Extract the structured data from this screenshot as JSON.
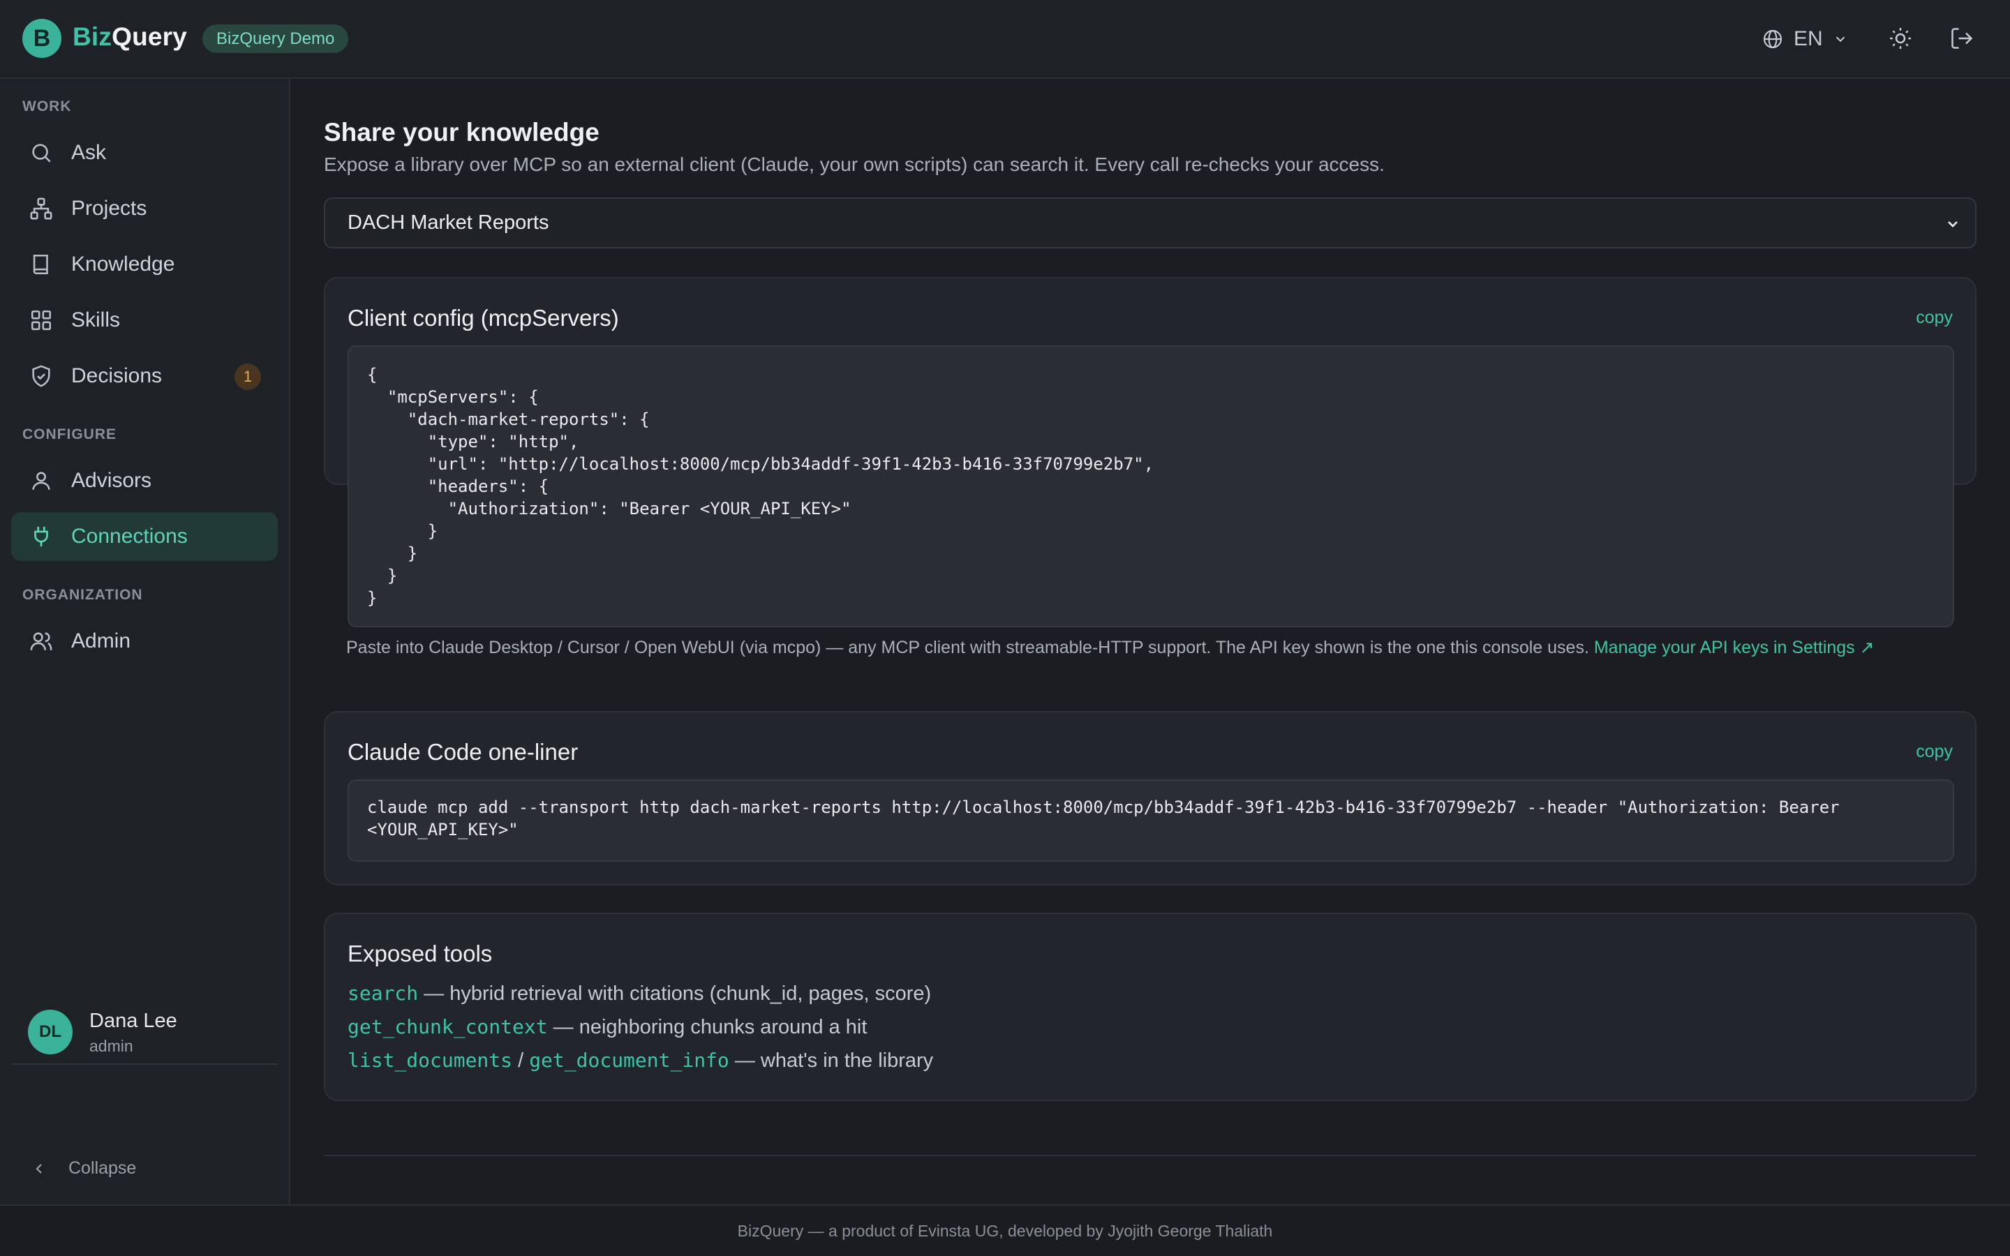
{
  "header": {
    "logo_letter": "B",
    "brand_part1": "Biz",
    "brand_part2": "Query",
    "badge": "BizQuery Demo",
    "language": "EN"
  },
  "sidebar": {
    "sections": {
      "work": "WORK",
      "configure": "CONFIGURE",
      "organization": "ORGANIZATION"
    },
    "items": [
      {
        "label": "Ask",
        "icon": "search-icon"
      },
      {
        "label": "Projects",
        "icon": "hierarchy-icon"
      },
      {
        "label": "Knowledge",
        "icon": "book-icon"
      },
      {
        "label": "Skills",
        "icon": "grid-icon"
      },
      {
        "label": "Decisions",
        "icon": "shield-check-icon",
        "badge": "1"
      },
      {
        "label": "Advisors",
        "icon": "user-icon"
      },
      {
        "label": "Connections",
        "icon": "plug-icon",
        "active": true
      },
      {
        "label": "Admin",
        "icon": "users-icon"
      }
    ],
    "user": {
      "initials": "DL",
      "name": "Dana Lee",
      "role": "admin"
    },
    "collapse_label": "Collapse"
  },
  "main": {
    "title": "Share your knowledge",
    "subtitle": "Expose a library over MCP so an external client (Claude, your own scripts) can search it. Every call re-checks your access.",
    "library_select": "DACH Market Reports",
    "client_config": {
      "title": "Client config (mcpServers)",
      "copy_label": "copy",
      "code": "{\n  \"mcpServers\": {\n    \"dach-market-reports\": {\n      \"type\": \"http\",\n      \"url\": \"http://localhost:8000/mcp/bb34addf-39f1-42b3-b416-33f70799e2b7\",\n      \"headers\": {\n        \"Authorization\": \"Bearer <YOUR_API_KEY>\"\n      }\n    }\n  }\n}",
      "hint": "Paste into Claude Desktop / Cursor / Open WebUI (via mcpo) — any MCP client with streamable-HTTP support. The API key shown is the one this console uses.",
      "hint_link": "Manage your API keys in Settings ↗"
    },
    "one_liner": {
      "title": "Claude Code one-liner",
      "copy_label": "copy",
      "code": "claude mcp add --transport http dach-market-reports http://localhost:8000/mcp/bb34addf-39f1-42b3-b416-33f70799e2b7 --header \"Authorization: Bearer\n<YOUR_API_KEY>\""
    },
    "tools": {
      "title": "Exposed tools",
      "lines": [
        {
          "names": [
            "search"
          ],
          "desc": " — hybrid retrieval with citations (chunk_id, pages, score)"
        },
        {
          "names": [
            "get_chunk_context"
          ],
          "desc": " — neighboring chunks around a hit"
        },
        {
          "names": [
            "list_documents",
            "get_document_info"
          ],
          "sep": " / ",
          "desc": " — what's in the library"
        }
      ]
    }
  },
  "footer": "BizQuery — a product of Evinsta UG, developed by Jyojith George Thaliath",
  "colors": {
    "accent": "#3fc4a8",
    "background": "#1b1d22",
    "card": "#22252b",
    "badge_warn": "#e6a95a"
  }
}
